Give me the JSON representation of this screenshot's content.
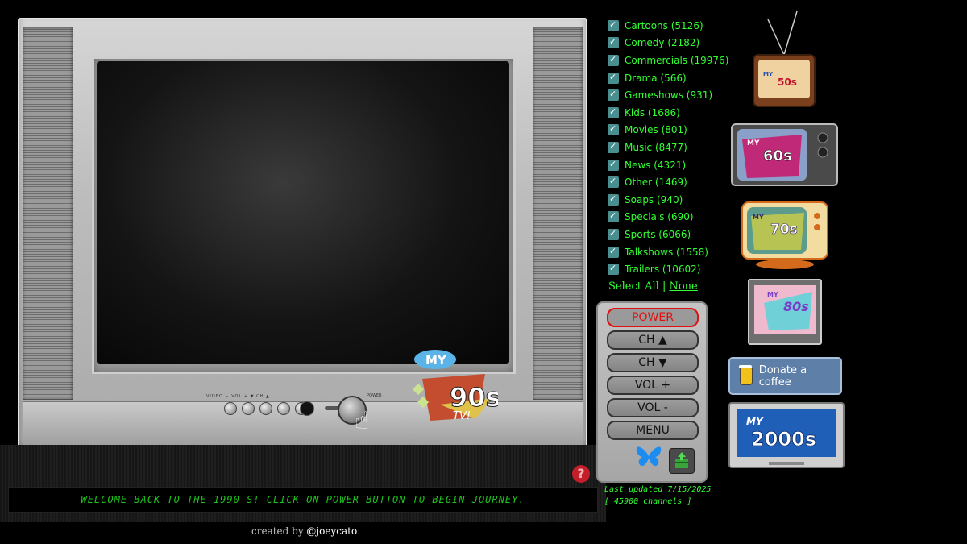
{
  "categories": [
    {
      "label": "Cartoons (5126)"
    },
    {
      "label": "Comedy (2182)"
    },
    {
      "label": "Commercials (19976)"
    },
    {
      "label": "Drama (566)"
    },
    {
      "label": "Gameshows (931)"
    },
    {
      "label": "Kids (1686)"
    },
    {
      "label": "Movies (801)"
    },
    {
      "label": "Music (8477)"
    },
    {
      "label": "News (4321)"
    },
    {
      "label": "Other (1469)"
    },
    {
      "label": "Soaps (940)"
    },
    {
      "label": "Specials (690)"
    },
    {
      "label": "Sports (6066)"
    },
    {
      "label": "Talkshows (1558)"
    },
    {
      "label": "Trailers (10602)"
    }
  ],
  "select": {
    "all": "Select All",
    "sep": "|",
    "none": "None"
  },
  "remote": {
    "power": "POWER",
    "ch_up": "CH ▲",
    "ch_down": "CH ▼",
    "vol_up": "VOL +",
    "vol_down": "VOL -",
    "menu": "MENU"
  },
  "updated": {
    "line1": "Last updated 7/15/2025",
    "line2": "[ 45900 channels ]"
  },
  "ticker": "WELCOME BACK TO THE 1990'S! CLICK ON POWER BUTTON TO BEGIN JOURNEY.",
  "credit": {
    "prefix": "created by",
    "handle": "@joeycato"
  },
  "help": "?",
  "donate": "Donate a coffee",
  "tv_panel": {
    "controls_text": "VIDEO  − VOL +  ▼ CH ▲",
    "power_label": "POWER"
  },
  "logos": {
    "my": "MY",
    "tv": "TV!",
    "d90": "90s",
    "d50": "50s",
    "d60": "60s",
    "d70": "70s",
    "d80": "80s",
    "d00": "2000s"
  },
  "colors": {
    "accent_green": "#33ff33",
    "ticker_green": "#1cc21c",
    "power_red": "#e01010"
  }
}
